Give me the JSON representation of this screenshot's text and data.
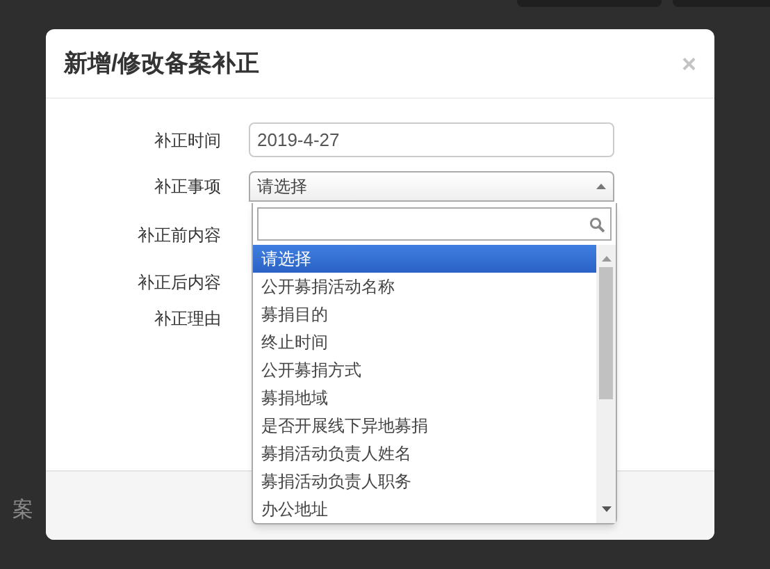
{
  "background": {
    "partial_text": "案"
  },
  "dialog": {
    "title": "新增/修改备案补正",
    "close": "×"
  },
  "form": {
    "fields": [
      {
        "label": "补正时间",
        "kind": "text",
        "value": "2019-4-27"
      },
      {
        "label": "补正事项",
        "kind": "select",
        "value": "请选择",
        "expanded": true
      },
      {
        "label": "补正前内容",
        "kind": "covered"
      },
      {
        "label": "补正后内容",
        "kind": "covered"
      },
      {
        "label": "补正理由",
        "kind": "covered"
      }
    ]
  },
  "dropdown": {
    "options": [
      {
        "label": "请选择",
        "selected": true
      },
      {
        "label": "公开募捐活动名称",
        "selected": false
      },
      {
        "label": "募捐目的",
        "selected": false
      },
      {
        "label": "终止时间",
        "selected": false
      },
      {
        "label": "公开募捐方式",
        "selected": false
      },
      {
        "label": "募捐地域",
        "selected": false
      },
      {
        "label": "是否开展线下异地募捐",
        "selected": false
      },
      {
        "label": "募捐活动负责人姓名",
        "selected": false
      },
      {
        "label": "募捐活动负责人职务",
        "selected": false
      },
      {
        "label": "办公地址",
        "selected": false
      }
    ]
  }
}
